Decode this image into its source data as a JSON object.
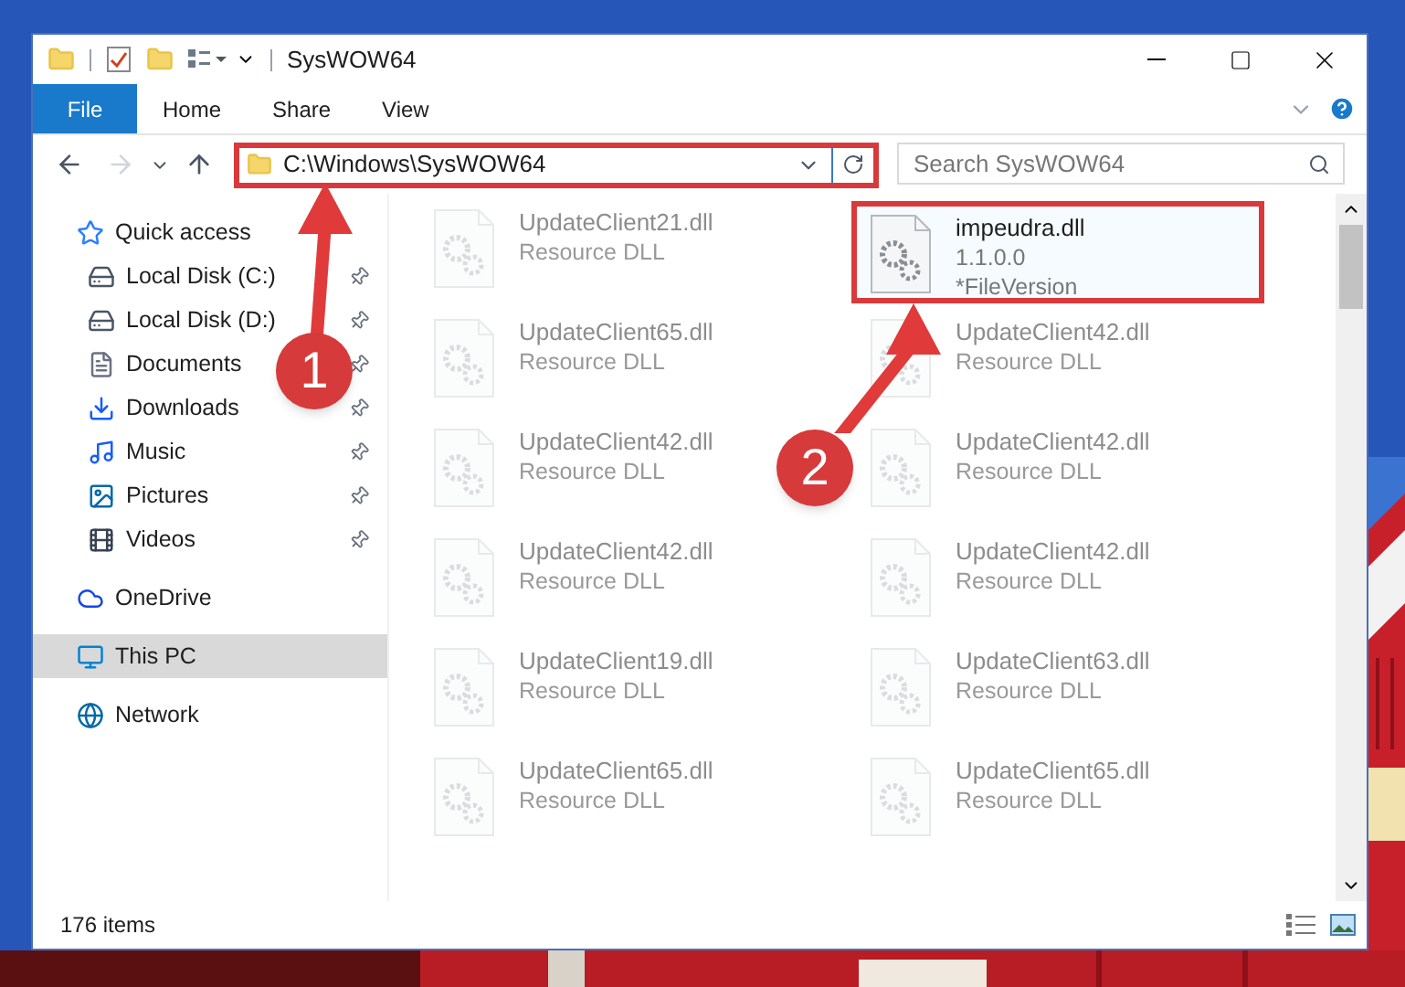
{
  "window": {
    "title": "SysWOW64"
  },
  "ribbon_tabs": [
    {
      "label": "File",
      "kind": "file"
    },
    {
      "label": "Home",
      "kind": "tab"
    },
    {
      "label": "Share",
      "kind": "tab"
    },
    {
      "label": "View",
      "kind": "tab"
    }
  ],
  "address_bar": {
    "path": "C:\\Windows\\SysWOW64",
    "highlighted": true
  },
  "search": {
    "placeholder": "Search SysWOW64"
  },
  "sidebar": {
    "items": [
      {
        "label": "Quick access",
        "selected": false,
        "children": [
          {
            "label": "Local Disk (C:)",
            "pinned": true
          },
          {
            "label": "Local Disk (D:)",
            "pinned": true
          },
          {
            "label": "Documents",
            "pinned": true
          },
          {
            "label": "Downloads",
            "pinned": true
          },
          {
            "label": "Music",
            "pinned": true
          },
          {
            "label": "Pictures",
            "pinned": true
          },
          {
            "label": "Videos",
            "pinned": true
          }
        ]
      },
      {
        "label": "OneDrive",
        "selected": false
      },
      {
        "label": "This PC",
        "selected": true
      },
      {
        "label": "Network",
        "selected": false
      }
    ]
  },
  "files": [
    {
      "name": "UpdateClient21.dll",
      "details": [
        "Resource DLL"
      ],
      "faded": true,
      "highlighted": false
    },
    {
      "name": "impeudra.dll",
      "details": [
        "1.1.0.0",
        "*FileVersion"
      ],
      "faded": false,
      "highlighted": true
    },
    {
      "name": "UpdateClient65.dll",
      "details": [
        "Resource DLL"
      ],
      "faded": true,
      "highlighted": false
    },
    {
      "name": "UpdateClient42.dll",
      "details": [
        "Resource DLL"
      ],
      "faded": true,
      "highlighted": false
    },
    {
      "name": "UpdateClient42.dll",
      "details": [
        "Resource DLL"
      ],
      "faded": true,
      "highlighted": false
    },
    {
      "name": "UpdateClient42.dll",
      "details": [
        "Resource DLL"
      ],
      "faded": true,
      "highlighted": false
    },
    {
      "name": "UpdateClient42.dll",
      "details": [
        "Resource DLL"
      ],
      "faded": true,
      "highlighted": false
    },
    {
      "name": "UpdateClient42.dll",
      "details": [
        "Resource DLL"
      ],
      "faded": true,
      "highlighted": false
    },
    {
      "name": "UpdateClient19.dll",
      "details": [
        "Resource DLL"
      ],
      "faded": true,
      "highlighted": false
    },
    {
      "name": "UpdateClient63.dll",
      "details": [
        "Resource DLL"
      ],
      "faded": true,
      "highlighted": false
    },
    {
      "name": "UpdateClient65.dll",
      "details": [
        "Resource DLL"
      ],
      "faded": true,
      "highlighted": false
    },
    {
      "name": "UpdateClient65.dll",
      "details": [
        "Resource DLL"
      ],
      "faded": true,
      "highlighted": false
    }
  ],
  "status_bar": {
    "count": "176 items"
  },
  "annotations": [
    {
      "number": "1"
    },
    {
      "number": "2"
    }
  ]
}
